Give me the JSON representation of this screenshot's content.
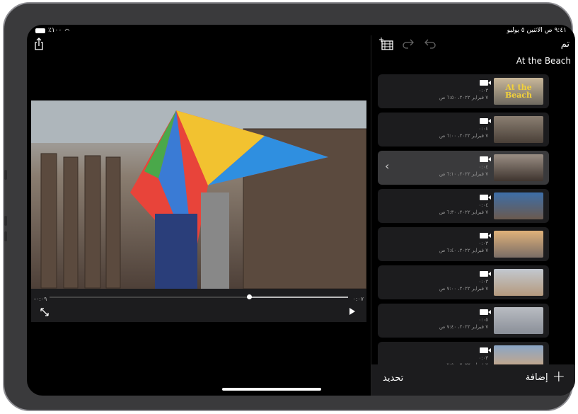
{
  "status_bar": {
    "time_date": "٩:٤١ ص  الاثنين ٥ يوليو",
    "battery": "٪١٠٠"
  },
  "header": {
    "done_label": "تم",
    "project_title": "At the Beach"
  },
  "player": {
    "remaining": "-٠:٠٩",
    "elapsed": "٠:٠٧",
    "progress_fraction": 0.33
  },
  "clips": [
    {
      "duration": "٠:٠٣",
      "date": "٧ فبراير ٢٠٢٢، ٦:٥٠ ص",
      "thumb_text": "At the Beach",
      "thumb_colors": [
        "#c9b79a",
        "#6f6a60"
      ],
      "selected": false
    },
    {
      "duration": "٠:٠٤",
      "date": "٧ فبراير ٢٠٢٢، ٦:٠٠ ص",
      "thumb_colors": [
        "#8b7f72",
        "#4a4038"
      ],
      "selected": false
    },
    {
      "duration": "٠:٠٤",
      "date": "٧ فبراير ٢٠٢٢، ٦:١٠ ص",
      "thumb_colors": [
        "#9a8e84",
        "#3e342e"
      ],
      "selected": true
    },
    {
      "duration": "٠:٠٤",
      "date": "٧ فبراير ٢٠٢٢، ٦:٣٠ ص",
      "thumb_colors": [
        "#3d6ea8",
        "#6b5a4e"
      ],
      "selected": false
    },
    {
      "duration": "٠:٠٣",
      "date": "٧ فبراير ٢٠٢٢، ٦:٤٠ ص",
      "thumb_colors": [
        "#e0b27a",
        "#7a6d66"
      ],
      "selected": false
    },
    {
      "duration": "٠:٠٣",
      "date": "٧ فبراير ٢٠٢٢، ٧:٠٠ ص",
      "thumb_colors": [
        "#c2c8cf",
        "#b59a7e"
      ],
      "selected": false
    },
    {
      "duration": "٠:٠٥",
      "date": "٧ فبراير ٢٠٢٢، ٧:٤٠ ص",
      "thumb_colors": [
        "#b9bcc2",
        "#8a8f98"
      ],
      "selected": false
    },
    {
      "duration": "٠:٠٣",
      "date": "٧ فبراير ٢٠٢٢، ٧:٥٠ ص",
      "thumb_colors": [
        "#8aa5c6",
        "#d6a878"
      ],
      "selected": false
    }
  ],
  "toolbar": {
    "add_label": "إضافة",
    "select_label": "تحديد"
  },
  "icons": {
    "share": "share-icon",
    "add_clip": "add-clip-film-icon",
    "redo": "redo-icon",
    "undo": "undo-icon",
    "expand": "fullscreen-icon",
    "play": "play-icon",
    "camera": "video-camera-icon",
    "chevron": "chevron-left-icon",
    "plus": "plus-icon"
  }
}
